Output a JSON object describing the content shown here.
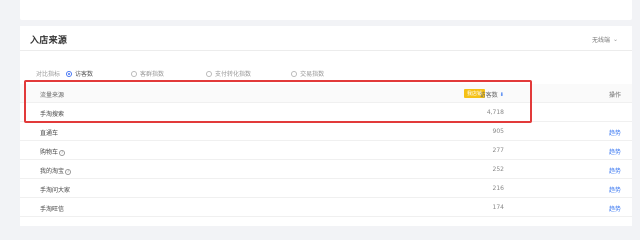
{
  "section_title": "入店来源",
  "filter": {
    "value": "无线端",
    "icon": "chevron-down-icon"
  },
  "metrics": {
    "label": "对比指标",
    "options": [
      {
        "label": "访客数",
        "selected": true
      },
      {
        "label": "客群指数",
        "selected": false
      },
      {
        "label": "支付转化指数",
        "selected": false
      },
      {
        "label": "交易指数",
        "selected": false
      }
    ]
  },
  "table": {
    "header": {
      "source": "流量来源",
      "badge": "我店铺",
      "visitors": "访客数",
      "action": "操作"
    },
    "rows": [
      {
        "source": "手淘搜索",
        "visitors": "4,718",
        "action": "",
        "help": false
      },
      {
        "source": "直通车",
        "visitors": "905",
        "action": "趋势",
        "help": false
      },
      {
        "source": "购物车",
        "visitors": "277",
        "action": "趋势",
        "help": true
      },
      {
        "source": "我的淘宝",
        "visitors": "252",
        "action": "趋势",
        "help": true
      },
      {
        "source": "手淘问大家",
        "visitors": "216",
        "action": "趋势",
        "help": false
      },
      {
        "source": "手淘旺信",
        "visitors": "174",
        "action": "趋势",
        "help": false
      }
    ]
  },
  "colors": {
    "accent": "#3a78f2",
    "badge": "#f5c116",
    "highlight": "#e23a3a"
  }
}
